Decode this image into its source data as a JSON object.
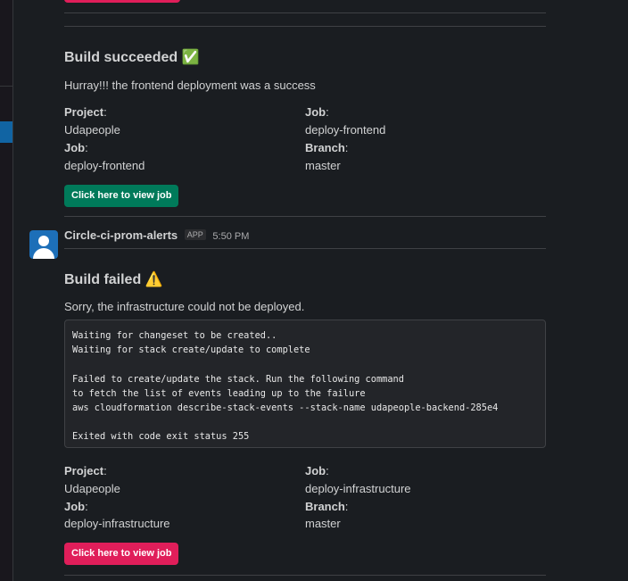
{
  "message1": {
    "title": "Build succeeded",
    "title_emoji": "✅",
    "subtitle": "Hurray!!! the frontend deployment was a success",
    "fields": [
      {
        "label": "Project",
        "value": "Udapeople"
      },
      {
        "label": "Job",
        "value": "deploy-frontend"
      },
      {
        "label": "Job",
        "value": "deploy-frontend"
      },
      {
        "label": "Branch",
        "value": "master"
      }
    ],
    "button": "Click here to view job"
  },
  "message2": {
    "sender": "Circle-ci-prom-alerts",
    "app_badge": "APP",
    "time": "5:50 PM",
    "title": "Build failed",
    "title_emoji": "⚠️",
    "subtitle": "Sorry, the infrastructure could not be deployed.",
    "code": "Waiting for changeset to be created..\nWaiting for stack create/update to complete\n\nFailed to create/update the stack. Run the following command\nto fetch the list of events leading up to the failure\naws cloudformation describe-stack-events --stack-name udapeople-backend-285e4\n\nExited with code exit status 255",
    "fields": [
      {
        "label": "Project",
        "value": "Udapeople"
      },
      {
        "label": "Job",
        "value": "deploy-infrastructure"
      },
      {
        "label": "Job",
        "value": "deploy-infrastructure"
      },
      {
        "label": "Branch",
        "value": "master"
      }
    ],
    "button": "Click here to view job"
  },
  "colors": {
    "success_button": "#007a5a",
    "fail_button": "#e01e5a",
    "avatar": "#1d6fb8",
    "sidebar_active": "#1164a3"
  }
}
